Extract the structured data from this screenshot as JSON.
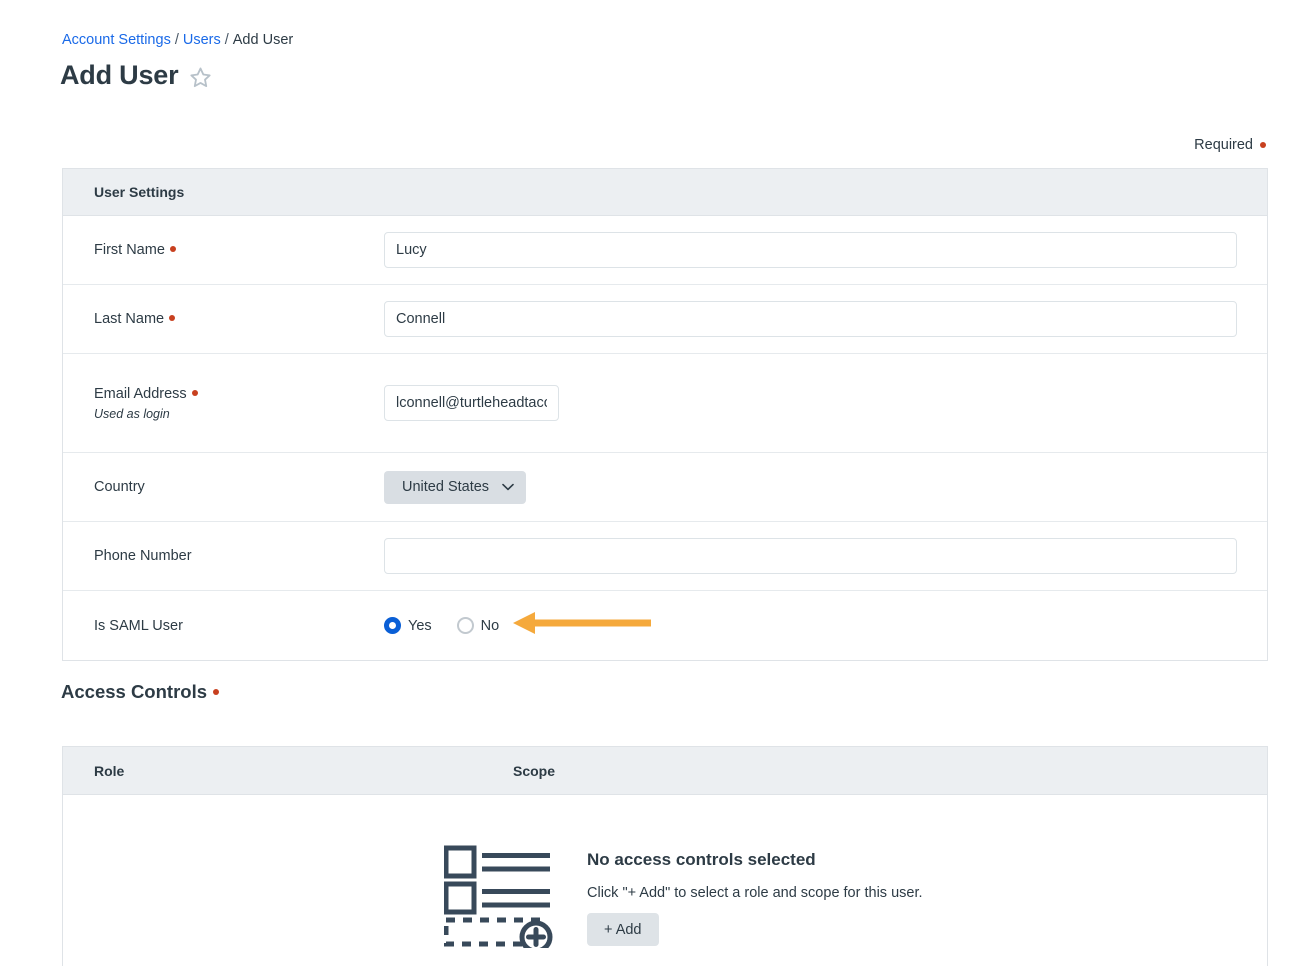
{
  "breadcrumb": {
    "account_settings": "Account Settings",
    "users": "Users",
    "current": "Add User",
    "separator": "/"
  },
  "header": {
    "title": "Add User",
    "favorite_icon": "star-icon"
  },
  "required_legend": {
    "label": "Required"
  },
  "user_settings": {
    "panel_title": "User Settings",
    "rows": {
      "first_name": {
        "label": "First Name",
        "required": true,
        "value": "Lucy"
      },
      "last_name": {
        "label": "Last Name",
        "required": true,
        "value": "Connell"
      },
      "email": {
        "label": "Email Address",
        "sublabel": "Used as login",
        "required": true,
        "value": "lconnell@turtleheadtacc"
      },
      "country": {
        "label": "Country",
        "required": false,
        "value": "United States",
        "icon": "chevron-down-icon"
      },
      "phone": {
        "label": "Phone Number",
        "required": false,
        "value": ""
      },
      "saml": {
        "label": "Is SAML User",
        "required": false,
        "option_yes": "Yes",
        "option_no": "No",
        "selected": "Yes"
      }
    }
  },
  "access_controls": {
    "heading": "Access Controls",
    "required": true,
    "columns": {
      "role": "Role",
      "scope": "Scope"
    },
    "empty_state": {
      "title": "No access controls selected",
      "description": "Click \"+ Add\" to select a role and scope for this user.",
      "add_button": "+ Add",
      "illustration": "checklist-add-icon"
    }
  },
  "annotation": {
    "arrow": "left-arrow-annotation",
    "color": "#f5a93c"
  },
  "colors": {
    "link": "#1a6ae8",
    "required_dot": "#c8401f",
    "radio_selected": "#0a5fd6",
    "panel_header_bg": "#eceff2",
    "text": "#2d3b45",
    "annotation_orange": "#f5a93c"
  }
}
